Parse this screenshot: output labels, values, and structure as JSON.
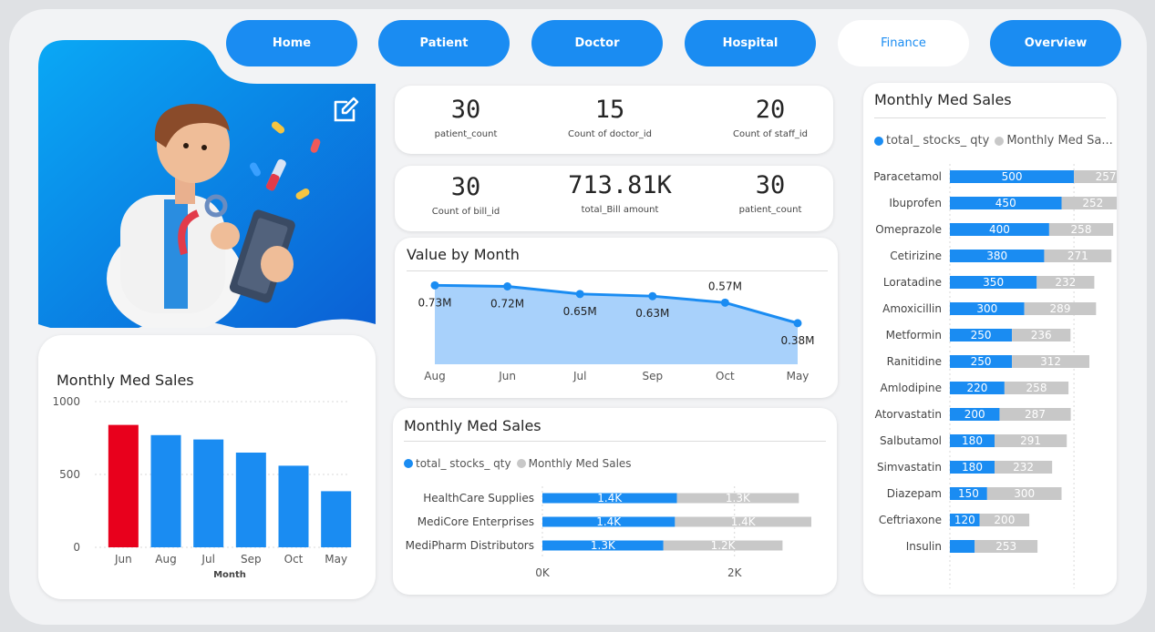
{
  "nav": {
    "home": "Home",
    "patient": "Patient",
    "doctor": "Doctor",
    "hospital": "Hospital",
    "finance": "Finance",
    "overview": "Overview"
  },
  "colors": {
    "accent": "#1a8cf2",
    "highlight": "#e8001c",
    "secondary": "#c8c8c8"
  },
  "icons": {
    "edit": "edit-icon"
  },
  "kpis_row1": [
    {
      "value": "30",
      "label": "patient_count"
    },
    {
      "value": "15",
      "label": "Count of doctor_id"
    },
    {
      "value": "20",
      "label": "Count of staff_id"
    }
  ],
  "kpis_row2": [
    {
      "value": "30",
      "label": "Count of bill_id"
    },
    {
      "value": "713.81K",
      "label": "total_Bill amount"
    },
    {
      "value": "30",
      "label": "patient_count"
    }
  ],
  "chart_data": [
    {
      "id": "left_bar",
      "type": "bar",
      "title": "Monthly Med Sales",
      "xlabel": "Month",
      "ylabel": "",
      "categories": [
        "Jun",
        "Aug",
        "Jul",
        "Sep",
        "Oct",
        "May"
      ],
      "values": [
        840,
        770,
        740,
        650,
        560,
        385
      ],
      "highlight_index": 0,
      "yticks": [
        0,
        500,
        1000
      ],
      "ylim": [
        0,
        1000
      ],
      "ytick_labels": [
        "0",
        "500",
        "1000"
      ]
    },
    {
      "id": "value_by_month",
      "type": "area",
      "title": "Value by Month",
      "categories": [
        "Aug",
        "Jun",
        "Jul",
        "Sep",
        "Oct",
        "May"
      ],
      "values": [
        0.73,
        0.72,
        0.65,
        0.63,
        0.57,
        0.38
      ],
      "labels": [
        "0.73M",
        "0.72M",
        "0.65M",
        "0.63M",
        "0.57M",
        "0.38M"
      ],
      "ylim": [
        0,
        0.8
      ]
    },
    {
      "id": "supplier_bar",
      "type": "bar",
      "orientation": "horizontal-stacked",
      "title": "Monthly Med Sales",
      "legend": [
        "total_ stocks_ qty",
        "Monthly Med Sales"
      ],
      "legend_placement": "top-left",
      "categories": [
        "HealthCare Supplies",
        "MediCore Enterprises",
        "MediPharm Distributors"
      ],
      "series": [
        {
          "name": "total_ stocks_ qty",
          "values": [
            1400,
            1380,
            1260
          ],
          "labels": [
            "1.4K",
            "1.4K",
            "1.3K"
          ]
        },
        {
          "name": "Monthly Med Sales",
          "values": [
            1270,
            1420,
            1240
          ],
          "labels": [
            "1.3K",
            "1.4K",
            "1.2K"
          ]
        }
      ],
      "xticks": [
        0,
        2000
      ],
      "xtick_labels": [
        "0K",
        "2K"
      ],
      "xlim": [
        0,
        2800
      ]
    },
    {
      "id": "medicine_bar",
      "type": "bar",
      "orientation": "horizontal-stacked",
      "title": "Monthly Med Sales",
      "legend": [
        "total_ stocks_ qty",
        "Monthly Med Sa..."
      ],
      "legend_placement": "top-left",
      "categories": [
        "Paracetamol",
        "Ibuprofen",
        "Omeprazole",
        "Cetirizine",
        "Loratadine",
        "Amoxicillin",
        "Metformin",
        "Ranitidine",
        "Amlodipine",
        "Atorvastatin",
        "Salbutamol",
        "Simvastatin",
        "Diazepam",
        "Ceftriaxone",
        "Insulin"
      ],
      "series": [
        {
          "name": "total_ stocks_ qty",
          "values": [
            500,
            450,
            400,
            380,
            350,
            300,
            250,
            250,
            220,
            200,
            180,
            180,
            150,
            120,
            100
          ],
          "labels": [
            "500",
            "450",
            "400",
            "380",
            "350",
            "300",
            "250",
            "250",
            "220",
            "200",
            "180",
            "180",
            "150",
            "120",
            ""
          ]
        },
        {
          "name": "Monthly Med Sales",
          "values": [
            257,
            252,
            258,
            271,
            232,
            289,
            236,
            312,
            258,
            287,
            291,
            232,
            300,
            200,
            253
          ],
          "labels": [
            "257",
            "252",
            "258",
            "271",
            "232",
            "289",
            "236",
            "312",
            "258",
            "287",
            "291",
            "232",
            "300",
            "200",
            "253"
          ]
        }
      ],
      "xticks": [
        0,
        500
      ],
      "xtick_labels": [
        "0",
        "500"
      ],
      "xlim": [
        0,
        900
      ]
    }
  ]
}
